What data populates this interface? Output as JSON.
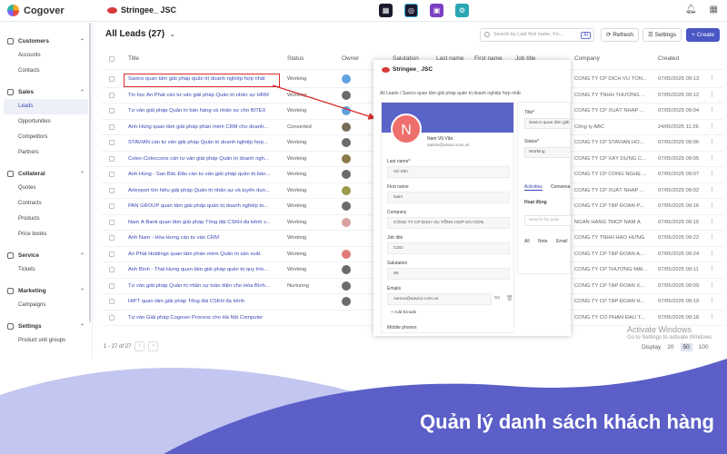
{
  "app": {
    "name": "Cogover",
    "org": "Stringee_ JSC",
    "app_icons": [
      "dashboard-app-icon",
      "crm-app-icon",
      "chat-app-icon",
      "settings-app-icon"
    ]
  },
  "sidebar": {
    "groups": [
      {
        "label": "Customers",
        "items": [
          "Accounts",
          "Contacts"
        ]
      },
      {
        "label": "Sales",
        "items": [
          "Leads",
          "Opportunities",
          "Competitors",
          "Partners"
        ]
      },
      {
        "label": "Collateral",
        "items": [
          "Quotes",
          "Contracts",
          "Products",
          "Price books"
        ]
      },
      {
        "label": "Service",
        "items": [
          "Tickets"
        ]
      },
      {
        "label": "Marketing",
        "items": [
          "Campaigns"
        ]
      },
      {
        "label": "Settings",
        "items": [
          "Product unit groups"
        ]
      }
    ],
    "active_item": "Leads"
  },
  "main": {
    "title": "All Leads (27)",
    "search_placeholder": "Search by Last first name, Fo...",
    "ai_label": "AI",
    "refresh_label": "Refresh",
    "settings_label": "Settings",
    "create_label": "+ Create"
  },
  "table": {
    "columns": {
      "title": "Title",
      "status": "Status",
      "owner": "Owner",
      "salutation": "Salutation",
      "last_name": "Last name",
      "first_name": "First name",
      "job_title": "Job title",
      "company": "Company",
      "created": "Created"
    },
    "rows": [
      {
        "title": "Savico quan tâm giải pháp quản trị doanh nghiệp hợp nhất",
        "status": "Working",
        "owner_color": "#5fa3e0",
        "company": "CÔNG TY CP DỊCH VỤ TỔN...",
        "created": "07/05/2025 09:13"
      },
      {
        "title": "Tin học An Phát cần tư vấn giải pháp Quản trị nhân sự HRM",
        "status": "Working",
        "owner_color": "#6b6b6b",
        "company": "CÔNG TY TNHH THƯƠNG ...",
        "created": "07/05/2025 09:12"
      },
      {
        "title": "Tư vấn giải pháp Quản trị bán hàng và nhân sự cho BITEX",
        "status": "Working",
        "owner_color": "#5fa3e0",
        "company": "CÔNG TY CP XUẤT NHẬP ...",
        "created": "07/05/2025 09:04"
      },
      {
        "title": "Anh Hùng quan tâm giải pháp phần mềm CRM cho doanh...",
        "status": "Converted",
        "owner_color": "#7a6a5a",
        "company": "Công ty ABC",
        "created": "24/05/2025 11:26"
      },
      {
        "title": "STAVIAN cần tư vấn giải pháp Quản trị doanh nghiệp hợp...",
        "status": "Working",
        "owner_color": "#6b6b6b",
        "company": "CÔNG TY CP STAVIAN HÓ...",
        "created": "07/05/2025 09:06"
      },
      {
        "title": "Cotec-Coteccons cần tư vấn giải pháp Quản trị doanh ngh...",
        "status": "Working",
        "owner_color": "#8a7a4a",
        "company": "CÔNG TY CP XÂY DỰNG C...",
        "created": "07/05/2025 09:05"
      },
      {
        "title": "Anh Hùng - Sao Bắc Đẩu cần tư vấn giải pháp quản trị bán...",
        "status": "Working",
        "owner_color": "#6b6b6b",
        "company": "CÔNG TY CP CÔNG NGHỆ ...",
        "created": "07/05/2025 09:07"
      },
      {
        "title": "Artexport tìm hiểu giải pháp Quản trị nhân sự và tuyển dụn...",
        "status": "Working",
        "owner_color": "#9a9a4a",
        "company": "CÔNG TY CP XUẤT NHẬP ...",
        "created": "07/05/2025 09:02"
      },
      {
        "title": "PAN GROUP quan tâm giải pháp quản trị doanh nghiệp to...",
        "status": "Working",
        "owner_color": "#6b6b6b",
        "company": "CÔNG TY CP TẬP ĐOÀN P...",
        "created": "07/05/2025 09:16"
      },
      {
        "title": "Nam Á Bank quan tâm giải pháp Tổng đài CSKH đa kênh v...",
        "status": "Working",
        "owner_color": "#d9a0a0",
        "company": "NGÂN HÀNG TMCP NAM Á",
        "created": "07/05/2025 09:15"
      },
      {
        "title": "Anh Nam - Hòa Hưng cần tư vấn CRM",
        "status": "Working",
        "owner_color": "",
        "company": "CÔNG TY TNHH HÀO HƯNG",
        "created": "07/05/2025 09:22"
      },
      {
        "title": "An Phát Holdings quan tâm phần mềm Quản trị sản xuất",
        "status": "Working",
        "owner_color": "#e07a7a",
        "company": "CÔNG TY CP TẬP ĐOÀN A...",
        "created": "07/05/2025 09:24"
      },
      {
        "title": "Anh Bình - Thái Hưng quan tâm giải pháp quản trị quy trìn...",
        "status": "Working",
        "owner_color": "#6b6b6b",
        "company": "CÔNG TY CP THƯƠNG MẠI...",
        "created": "07/05/2025 09:11"
      },
      {
        "title": "Tư vấn giải pháp Quản trị nhân sự toàn diện cho Hòa Bình...",
        "status": "Nurturing",
        "owner_color": "#6b6b6b",
        "company": "CÔNG TY CP TẬP ĐOÀN X...",
        "created": "07/05/2025 09:09"
      },
      {
        "title": "HIPT quan tâm giải pháp Tổng đài CSKH đa kênh",
        "status": "",
        "owner_color": "#6b6b6b",
        "company": "CÔNG TY CP TẬP ĐOÀN H...",
        "created": "07/05/2025 09:19"
      },
      {
        "title": "Tư vấn Giải pháp Cogover Process cho Hà Nội Computer",
        "status": "",
        "owner_color": "",
        "company": "CÔNG TY CỔ PHẦN ĐẦU T...",
        "created": "07/05/2025 09:18"
      }
    ]
  },
  "footer": {
    "range": "1 - 27 of 27",
    "display_label": "Display",
    "page_sizes": [
      "20",
      "50",
      "100"
    ],
    "selected_page_size": "50",
    "watermark_title": "Activate Windows",
    "watermark_sub": "Go to Settings to activate Windows"
  },
  "detail": {
    "org": "Stringee_ JSC",
    "breadcrumb": "All Leads  /  Savico quan tâm giải pháp quản trị doanh nghiệp hợp nhất",
    "avatar_initial": "N",
    "name": "Nam Vũ Văn",
    "email": "namvv@savico.com.vn",
    "fields": [
      {
        "label": "Last name*",
        "value": "Vũ Văn"
      },
      {
        "label": "First name",
        "value": "Nam"
      },
      {
        "label": "Company",
        "value": "CÔNG TY CP DỊCH VỤ TỔNG HỢP SÀI GÒN"
      },
      {
        "label": "Job title",
        "value": "CDO"
      },
      {
        "label": "Salutation",
        "value": "Mr."
      },
      {
        "label": "Emails",
        "value": "namvv@savico.com.vn"
      }
    ],
    "email_count": "S2",
    "add_emails": "+ Add Emails",
    "mobile_phones": "Mobile phones",
    "right": {
      "title_label": "Title*",
      "title_value": "Savico quan tâm giải",
      "status_label": "Status*",
      "status_value": "Working",
      "tabs": [
        "Activities",
        "Conversa"
      ],
      "activity_heading": "Hoạt động",
      "search_placeholder": "Search for activ",
      "filters": [
        "All",
        "Note",
        "Email"
      ]
    }
  },
  "banner": {
    "caption": "Quản lý danh sách khách hàng",
    "color_light": "#c3c6f0",
    "color_dark": "#5b5fc7"
  }
}
